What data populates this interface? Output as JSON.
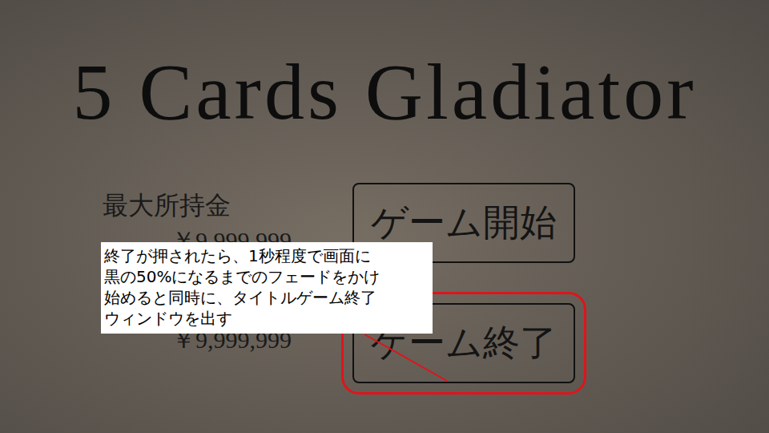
{
  "title": "5 Cards Gladiator",
  "stats": {
    "heading": "最大所持金",
    "values": [
      "￥9,999,999",
      "￥9,999,999"
    ]
  },
  "menu": [
    {
      "label": "ゲーム開始",
      "highlighted": false
    },
    {
      "label": "ゲーム終了",
      "highlighted": true
    }
  ],
  "callout": {
    "lines": [
      "終了が押されたら、1秒程度で画面に",
      "黒の50%になるまでのフェードをかけ",
      "始めると同時に、タイトルゲーム終了",
      "ウィンドウを出す"
    ]
  }
}
